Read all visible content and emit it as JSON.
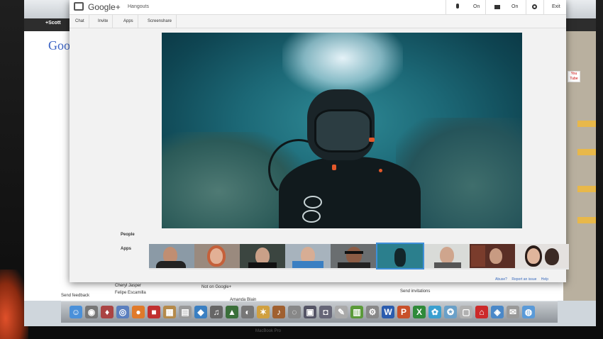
{
  "background_browser": {
    "nav_label": "+Scott",
    "logo_text": "Goo",
    "youtube_label": "You Tube",
    "bottom_items": [
      "Cheryl Jasper",
      "Felipe Escamilla",
      "Not on Google+",
      "Amanda Blain",
      "Send invitations",
      "Send feedback"
    ]
  },
  "hangout": {
    "brand": "Google+",
    "app_name": "Hangouts",
    "mic_status": "On",
    "camera_status": "On",
    "exit_label": "Exit",
    "tabs": [
      "Chat",
      "Invite",
      "Apps",
      "Screenshare"
    ],
    "left_menu": [
      "People",
      "Apps"
    ],
    "footer_links": [
      "Abuse?",
      "Report an issue",
      "Help"
    ],
    "participant_count": 9,
    "selected_participant_index": 4
  },
  "dock": {
    "letter_icons": [
      "W",
      "P",
      "X"
    ]
  },
  "laptop_label": "MacBook Pro",
  "colors": {
    "accent_blue": "#3f8fd8",
    "water": "#1c6876",
    "dock": "#b0b5ba"
  }
}
